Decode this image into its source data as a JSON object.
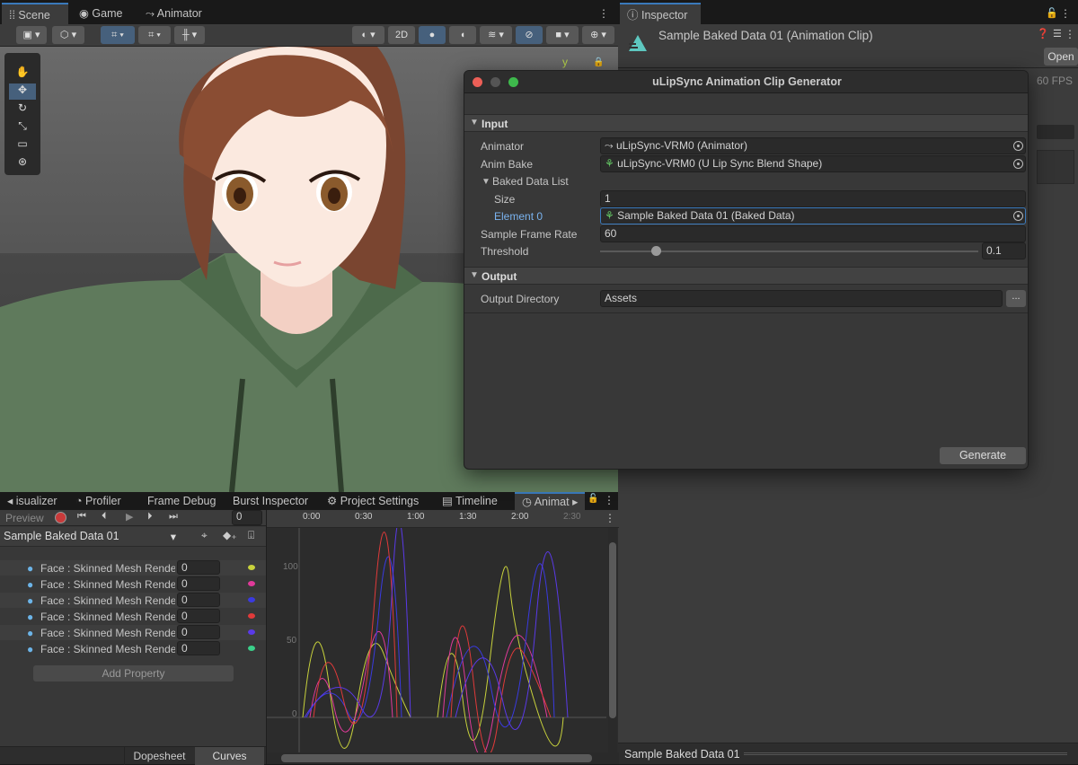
{
  "scene_tabs": {
    "scene": "Scene",
    "game": "Game",
    "animator": "Animator"
  },
  "scene_toolbar": {
    "mode_2d": "2D"
  },
  "gizmo": {
    "y_axis": "y"
  },
  "inspector": {
    "tab": "Inspector",
    "title": "Sample Baked Data 01 (Animation Clip)",
    "open_button": "Open",
    "fps": "60 FPS",
    "footer": "Sample Baked Data 01"
  },
  "dialog": {
    "title": "uLipSync Animation Clip Generator",
    "input_section": "Input",
    "animator_label": "Animator",
    "animator_value": "uLipSync-VRM0 (Animator)",
    "anim_bake_label": "Anim Bake",
    "anim_bake_value": "uLipSync-VRM0 (U Lip Sync Blend Shape)",
    "baked_list_label": "Baked Data List",
    "size_label": "Size",
    "size_value": "1",
    "element_label": "Element 0",
    "element_value": "Sample Baked Data 01 (Baked Data)",
    "frame_rate_label": "Sample Frame Rate",
    "frame_rate_value": "60",
    "threshold_label": "Threshold",
    "threshold_value": "0.1",
    "threshold_fraction": 0.1,
    "output_section": "Output",
    "output_dir_label": "Output Directory",
    "output_dir_value": "Assets",
    "browse": "...",
    "generate": "Generate"
  },
  "bottom_tabs": {
    "visualizer": "isualizer",
    "profiler": "Profiler",
    "frame_debug": "Frame Debug",
    "burst": "Burst Inspector",
    "project_settings": "Project Settings",
    "timeline": "Timeline",
    "animation": "Animat"
  },
  "animation": {
    "preview": "Preview",
    "frame": "0",
    "clip": "Sample Baked Data 01",
    "add_property": "Add Property",
    "dopesheet": "Dopesheet",
    "curves": "Curves",
    "properties": [
      {
        "label": "Face : Skinned Mesh Rende",
        "value": "0",
        "color": "#c8d23c"
      },
      {
        "label": "Face : Skinned Mesh Rende",
        "value": "0",
        "color": "#e03a9a"
      },
      {
        "label": "Face : Skinned Mesh Rende",
        "value": "0",
        "color": "#3a3ae0"
      },
      {
        "label": "Face : Skinned Mesh Rende",
        "value": "0",
        "color": "#e03a3a"
      },
      {
        "label": "Face : Skinned Mesh Rende",
        "value": "0",
        "color": "#5a3ae8"
      },
      {
        "label": "Face : Skinned Mesh Rende",
        "value": "0",
        "color": "#3ad08a"
      }
    ],
    "time_ticks": [
      "0:00",
      "0:30",
      "1:00",
      "1:30",
      "2:00",
      "2:30"
    ],
    "y_ticks": [
      "100",
      "50",
      "0"
    ]
  }
}
